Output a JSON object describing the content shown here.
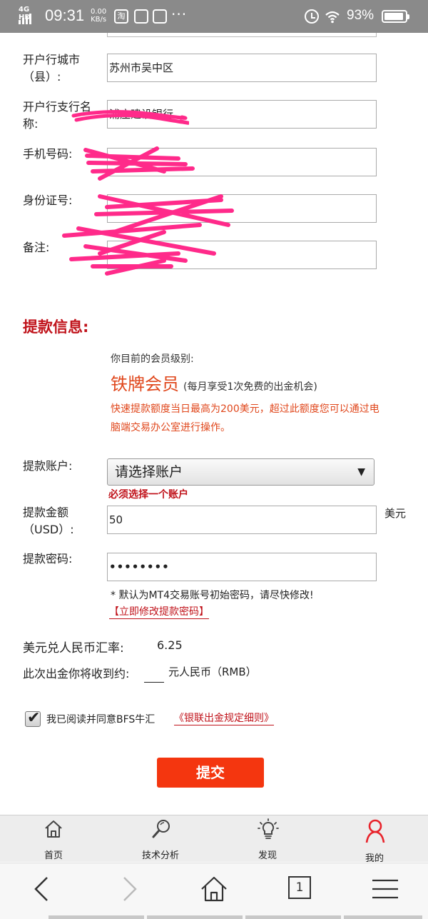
{
  "status_bar": {
    "network": "4G HD",
    "time": "09:31",
    "speed_value": "0.00",
    "speed_unit": "KB/s",
    "notif_taobao": "淘",
    "more": "···",
    "battery_pct_text": "93%",
    "battery_level": 0.93
  },
  "bank_form": {
    "city_label": "开户行城市（县）:",
    "city_value": "苏州市吴中区",
    "branch_label": "开户行支行名称:",
    "branch_value": "浦庄建设银行",
    "phone_label": "手机号码:",
    "id_label": "身份证号:",
    "remark_label": "备注:"
  },
  "withdraw": {
    "section_title": "提款信息:",
    "level_prompt": "你目前的会员级别:",
    "level_name": "铁牌会员",
    "level_note": "(每月享受1次免费的出金机会)",
    "level_desc": "快速提款额度当日最高为200美元，超过此额度您可以通过电脑端交易办公室进行操作。",
    "account_label": "提款账户:",
    "account_selected": "请选择账户",
    "account_required": "必须选择一个账户",
    "amount_label": "提款金额（USD）:",
    "amount_value": "50",
    "amount_unit": "美元",
    "password_label": "提款密码:",
    "password_value": "••••••••",
    "password_note": "* 默认为MT4交易账号初始密码，请尽快修改!",
    "password_link": "【立即修改提款密码】",
    "rate_label": "美元兑人民币汇率:",
    "rate_value": "6.25",
    "receive_label": "此次出金你将收到约:",
    "receive_value": "",
    "receive_unit": "元人民币（RMB）",
    "agree_label": "我已阅读并同意BFS牛汇",
    "agree_link": "《银联出金规定细则》",
    "agree_checked": true,
    "submit_label": "提交"
  },
  "tab_bar": [
    {
      "label": "首页",
      "icon": "home-icon"
    },
    {
      "label": "技术分析",
      "icon": "magnifier-icon"
    },
    {
      "label": "发现",
      "icon": "lightbulb-icon"
    },
    {
      "label": "我的",
      "icon": "user-icon",
      "active_color": "#e8232b"
    }
  ],
  "browser_bar": {
    "back_icon": "back-arrow-icon",
    "forward_icon": "forward-arrow-icon",
    "home_icon": "home-outline-icon",
    "tab_count": "1",
    "menu_icon": "menu-icon"
  },
  "colors": {
    "accent_red": "#c0121a",
    "level_orange": "#e0471c",
    "submit_bg": "#f4360f",
    "status_bar_bg": "#8a8a8a",
    "scribble_pink": "#ff2a8a"
  }
}
